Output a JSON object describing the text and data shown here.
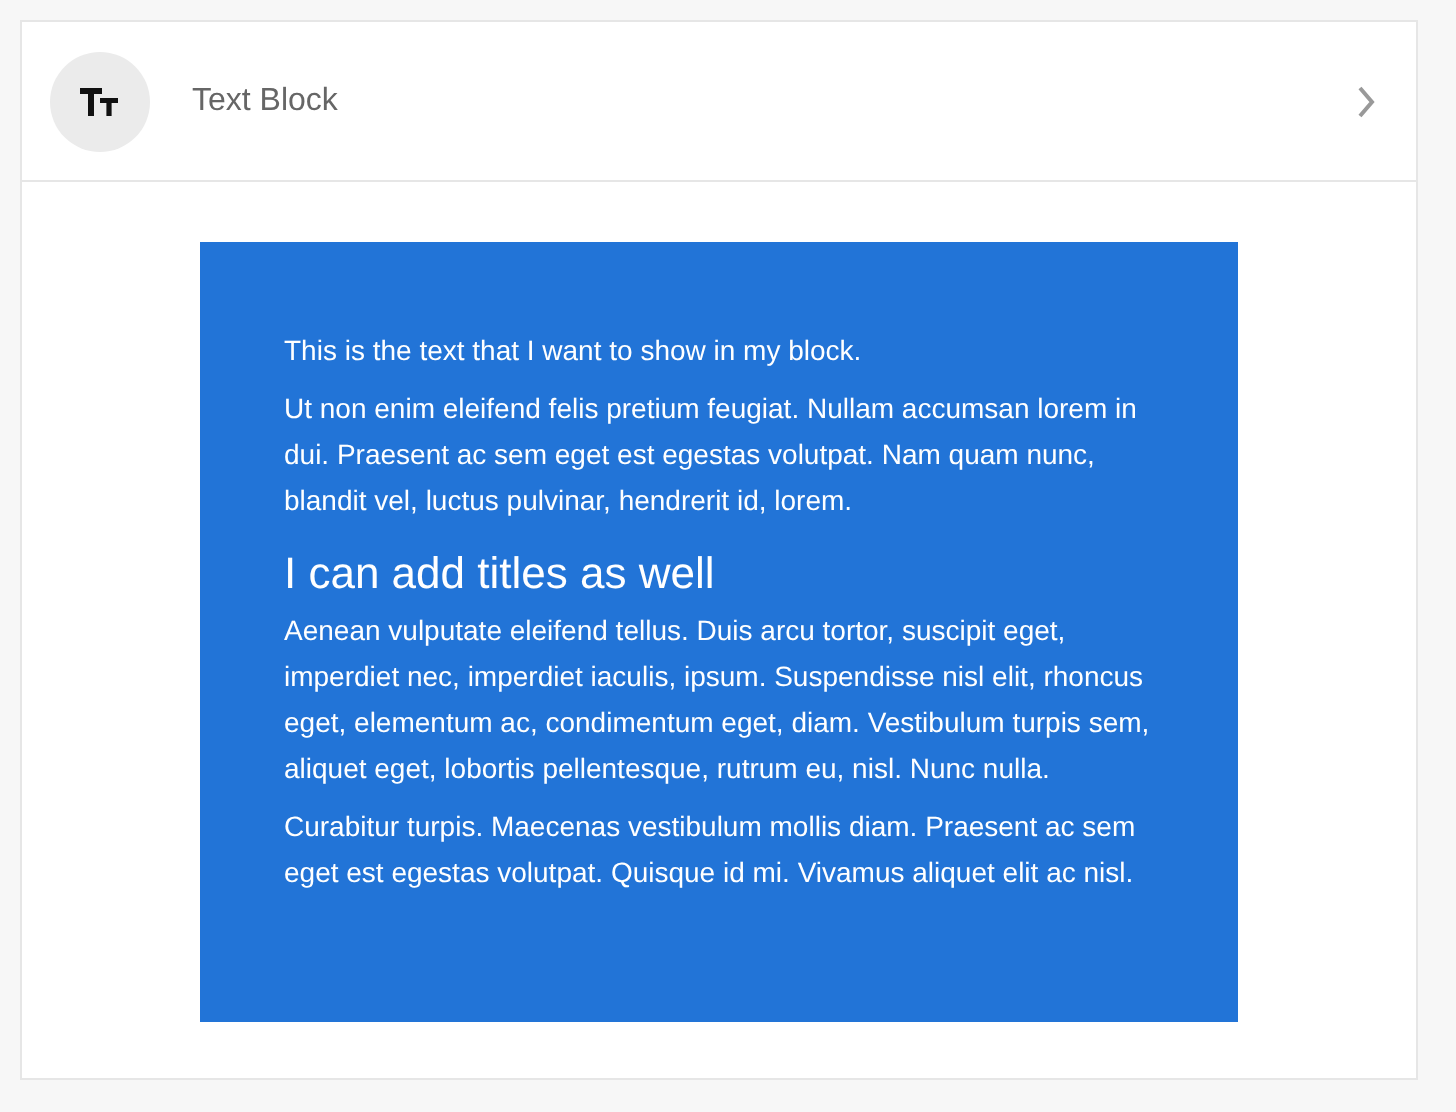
{
  "header": {
    "title": "Text Block"
  },
  "block": {
    "content": [
      {
        "kind": "paragraph",
        "text": "This is the text that I want to show in my block."
      },
      {
        "kind": "paragraph",
        "text": "Ut non enim eleifend felis pretium feugiat. Nullam accumsan lorem in dui. Praesent ac sem eget est egestas volutpat. Nam quam nunc, blandit vel, luctus pulvinar, hendrerit id, lorem."
      },
      {
        "kind": "heading",
        "text": "I can add titles as well"
      },
      {
        "kind": "paragraph",
        "text": "Aenean vulputate eleifend tellus. Duis arcu tortor, suscipit eget, imperdiet nec, imperdiet iaculis, ipsum. Suspendisse nisl elit, rhoncus eget, elementum ac, condimentum eget, diam. Vestibulum turpis sem, aliquet eget, lobortis pellentesque, rutrum eu, nisl. Nunc nulla."
      },
      {
        "kind": "paragraph",
        "text": "Curabitur turpis. Maecenas vestibulum mollis diam. Praesent ac sem eget est egestas volutpat. Quisque id mi. Vivamus aliquet elit ac nisl."
      }
    ]
  }
}
